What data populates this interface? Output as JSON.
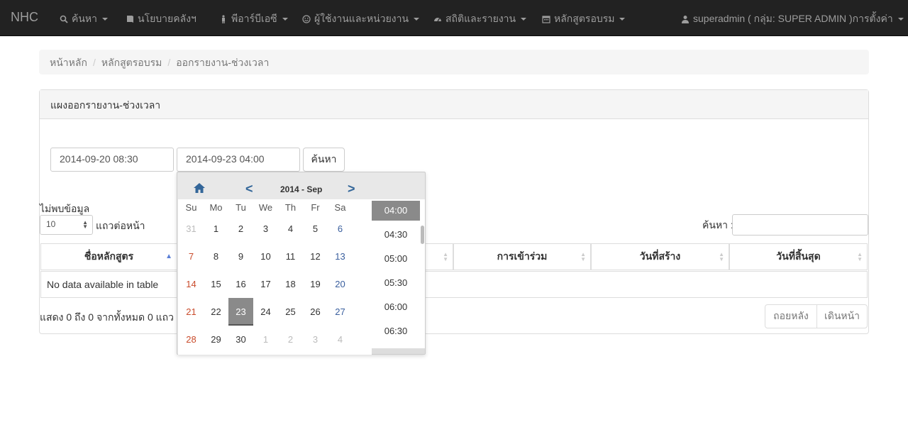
{
  "navbar": {
    "brand": "NHC",
    "items": [
      {
        "label": "ค้นหา",
        "icon": "search-icon"
      },
      {
        "label": "นโยบายคลังฯ",
        "icon": "book-icon"
      },
      {
        "label": "พีอาร์บีเอซี",
        "icon": "person-icon"
      },
      {
        "label": "ผู้ใช้งานและหน่วยงาน",
        "icon": "smile-icon"
      },
      {
        "label": "สถิติและรายงาน",
        "icon": "dashboard-icon"
      },
      {
        "label": "หลักสูตรอบรม",
        "icon": "calendar-icon"
      }
    ],
    "user": "superadmin ( กลุ่ม: SUPER ADMIN )การตั้งค่า"
  },
  "breadcrumb": {
    "home": "หน้าหลัก",
    "section": "หลักสูตรอบรม",
    "current": "ออกรายงาน-ช่วงเวลา",
    "separator": "/"
  },
  "panel": {
    "title": "แผงออกรายงาน-ช่วงเวลา",
    "start_value": "2014-09-20 08:30",
    "end_value": "2014-09-23 04:00",
    "search_button": "ค้นหา"
  },
  "table": {
    "no_data_info": "ไม่พบข้อมูล",
    "page_length": "10",
    "page_length_suffix": "แถวต่อหน้า",
    "search_label": "ค้นหา :",
    "columns": [
      "ชื่อหลักสูตร",
      "",
      "การเข้าร่วม",
      "วันที่สร้าง",
      "วันที่สิ้นสุด"
    ],
    "empty_message": "No data available in table",
    "summary": "แสดง 0 ถึง 0 จากทั้งหมด 0 แถว",
    "prev": "ถอยหลัง",
    "next": "เดินหน้า"
  },
  "datepicker": {
    "title": "2014 - Sep",
    "prev": "<",
    "next": ">",
    "days_of_week": [
      "Su",
      "Mo",
      "Tu",
      "We",
      "Th",
      "Fr",
      "Sa"
    ],
    "weeks": [
      [
        "31",
        "1",
        "2",
        "3",
        "4",
        "5",
        "6"
      ],
      [
        "7",
        "8",
        "9",
        "10",
        "11",
        "12",
        "13"
      ],
      [
        "14",
        "15",
        "16",
        "17",
        "18",
        "19",
        "20"
      ],
      [
        "21",
        "22",
        "23",
        "24",
        "25",
        "26",
        "27"
      ],
      [
        "28",
        "29",
        "30",
        "1",
        "2",
        "3",
        "4"
      ]
    ],
    "selected_day": "23",
    "times": [
      "04:00",
      "04:30",
      "05:00",
      "05:30",
      "06:00",
      "06:30"
    ],
    "selected_time": "04:00",
    "colors": {
      "sunday": "#c94b2b",
      "saturday": "#3a5f9e",
      "selected": "#8a8a8a",
      "nav": "#336699"
    }
  }
}
